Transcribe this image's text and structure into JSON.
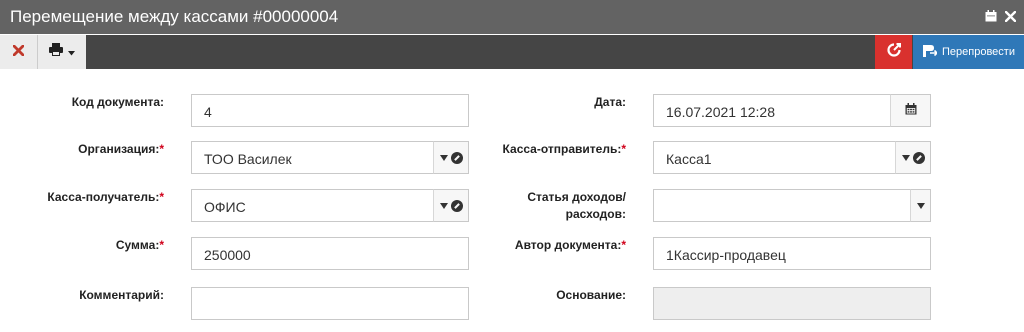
{
  "window": {
    "title": "Перемещение между кассами #00000004"
  },
  "toolbar": {
    "repost_label": "Перепровести"
  },
  "form": {
    "doc_code": {
      "label": "Код документа:",
      "value": "4"
    },
    "date": {
      "label": "Дата:",
      "value": "16.07.2021 12:28"
    },
    "organization": {
      "label": "Организация:",
      "required": "*",
      "value": "ТОО Василек"
    },
    "cash_sender": {
      "label": "Касса-отправитель:",
      "required": "*",
      "value": "Касса1"
    },
    "cash_receiver": {
      "label": "Касса-получатель:",
      "required": "*",
      "value": "ОФИС"
    },
    "income_item": {
      "label_line1": "Статья доходов/",
      "label_line2": "расходов:",
      "value": ""
    },
    "amount": {
      "label": "Сумма:",
      "required": "*",
      "value": "250000"
    },
    "author": {
      "label": "Автор документа:",
      "required": "*",
      "value": "1Кассир-продавец"
    },
    "comment": {
      "label": "Комментарий:",
      "value": ""
    },
    "basis": {
      "label": "Основание:",
      "value": ""
    }
  },
  "colors": {
    "titlebar": "#636363",
    "toolbar": "#454545",
    "exit_button": "#d9312e",
    "repost_button": "#2f78b8",
    "close_icon": "#c0392b",
    "required_mark": "#d0021b"
  },
  "icons": {
    "titlebar": [
      "calendar-icon",
      "close-icon"
    ],
    "toolbar": [
      "close-icon",
      "print-icon",
      "caret-down-icon",
      "exit-icon",
      "repost-icon"
    ]
  }
}
